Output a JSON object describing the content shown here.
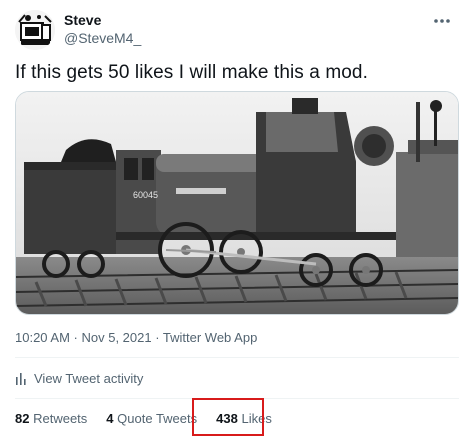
{
  "author": {
    "display_name": "Steve",
    "handle": "@SteveM4_",
    "avatar_icon": "cartoon-computer-avatar-icon"
  },
  "more_icon": "more-horizontal-icon",
  "tweet": {
    "text": "If this gets 50 likes I will make this a mod."
  },
  "media": {
    "subject": "black-and-white steam locomotive",
    "loco_number": "60045"
  },
  "meta": {
    "timestamp": "10:20 AM · Nov 5, 2021 · Twitter Web App"
  },
  "activity": {
    "icon": "bar-chart-icon",
    "label": "View Tweet activity"
  },
  "stats": {
    "retweets_count": "82",
    "retweets_label": "Retweets",
    "quotes_count": "4",
    "quotes_label": "Quote Tweets",
    "likes_count": "438",
    "likes_label": "Likes"
  },
  "colors": {
    "text_primary": "#0f1419",
    "text_secondary": "#536471",
    "divider": "#eff3f4",
    "highlight_border": "#d81b1b"
  }
}
